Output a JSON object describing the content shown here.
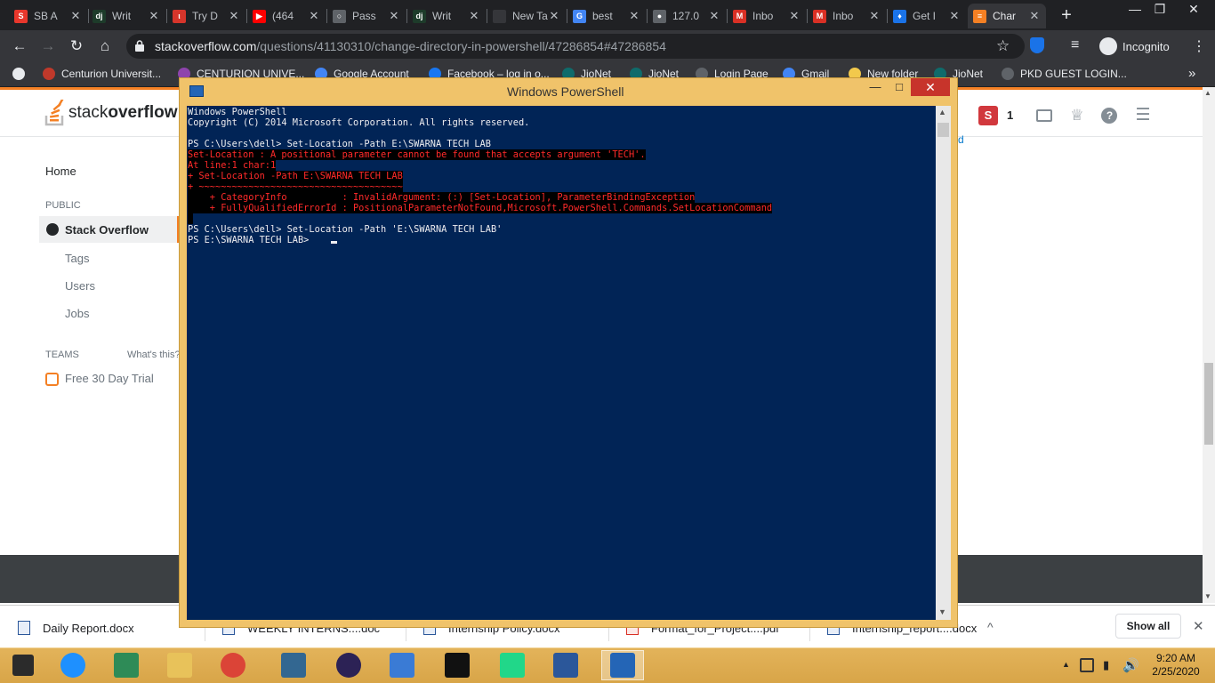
{
  "browser": {
    "tabs": [
      {
        "label": "SB A",
        "favicon": "S",
        "color": "#e8372c"
      },
      {
        "label": "Writ",
        "favicon": "dj",
        "color": "#1d3b2a"
      },
      {
        "label": "Try D",
        "favicon": "ι",
        "color": "#d6352b"
      },
      {
        "label": "(464",
        "favicon": "▶",
        "color": "#ff0000"
      },
      {
        "label": "Pass",
        "favicon": "○",
        "color": "#5f6368"
      },
      {
        "label": "Writ",
        "favicon": "dj",
        "color": "#1d3b2a"
      },
      {
        "label": "New Tab",
        "favicon": "",
        "color": "#35363a"
      },
      {
        "label": "best",
        "favicon": "G",
        "color": "#4285f4"
      },
      {
        "label": "127.0",
        "favicon": "●",
        "color": "#5f6368"
      },
      {
        "label": "Inbo",
        "favicon": "M",
        "color": "#d93025"
      },
      {
        "label": "Inbo",
        "favicon": "M",
        "color": "#d93025"
      },
      {
        "label": "Get I",
        "favicon": "♦",
        "color": "#1a73e8"
      },
      {
        "label": "Char",
        "favicon": "≡",
        "color": "#f48024"
      }
    ],
    "new_tab_label": "+",
    "window_controls": [
      "—",
      "❐",
      "✕"
    ],
    "url_host": "stackoverflow.com",
    "url_path": "/questions/41130310/change-directory-in-powershell/47286854#47286854",
    "incognito_label": "Incognito",
    "bookmarks": [
      {
        "label": "Centurion Universit...",
        "color": "#c0392b"
      },
      {
        "label": "CENTURION UNIVE...",
        "color": "#8e44ad"
      },
      {
        "label": "Google Account",
        "color": "#4285f4"
      },
      {
        "label": "Facebook – log in o...",
        "color": "#1877f2"
      },
      {
        "label": "JioNet",
        "color": "#0f6b6b"
      },
      {
        "label": "JioNet",
        "color": "#0f6b6b"
      },
      {
        "label": "Login Page",
        "color": "#5f6368"
      },
      {
        "label": "Gmail",
        "color": "#4285f4"
      },
      {
        "label": "New folder",
        "color": "#f2c94c"
      },
      {
        "label": "JioNet",
        "color": "#0f6b6b"
      },
      {
        "label": "PKD GUEST LOGIN...",
        "color": "#5f6368"
      }
    ],
    "more_bookmarks": "»"
  },
  "stackoverflow": {
    "logo_light": "stack",
    "logo_bold": "overflow",
    "nav_home": "Home",
    "nav_public": "PUBLIC",
    "nav_stackoverflow": "Stack Overflow",
    "nav_tags": "Tags",
    "nav_users": "Users",
    "nav_jobs": "Jobs",
    "nav_teams": "TEAMS",
    "nav_whats_this": "What's this?",
    "nav_trial": "Free 30 Day Trial",
    "avatar_letter": "S",
    "reputation": "1",
    "partial_link": "d"
  },
  "powershell": {
    "title": "Windows PowerShell",
    "lines": [
      {
        "text": "Windows PowerShell",
        "error": false
      },
      {
        "text": "Copyright (C) 2014 Microsoft Corporation. All rights reserved.",
        "error": false
      },
      {
        "text": "",
        "error": false
      },
      {
        "text": "PS C:\\Users\\dell> Set-Location -Path E:\\SWARNA TECH LAB",
        "error": false
      },
      {
        "text": "Set-Location : A positional parameter cannot be found that accepts argument 'TECH'.",
        "error": true
      },
      {
        "text": "At line:1 char:1",
        "error": true
      },
      {
        "text": "+ Set-Location -Path E:\\SWARNA TECH LAB",
        "error": true
      },
      {
        "text": "+ ~~~~~~~~~~~~~~~~~~~~~~~~~~~~~~~~~~~~~",
        "error": true
      },
      {
        "text": "    + CategoryInfo          : InvalidArgument: (:) [Set-Location], ParameterBindingException",
        "error": true
      },
      {
        "text": "    + FullyQualifiedErrorId : PositionalParameterNotFound,Microsoft.PowerShell.Commands.SetLocationCommand",
        "error": true
      },
      {
        "text": " ",
        "error": true
      },
      {
        "text": "PS C:\\Users\\dell> Set-Location -Path 'E:\\SWARNA TECH LAB'",
        "error": false
      },
      {
        "text": "PS E:\\SWARNA TECH LAB> ",
        "error": false
      }
    ],
    "controls": [
      "—",
      "□",
      "✕"
    ]
  },
  "downloads": {
    "items": [
      "Daily Report.docx",
      "WEEKLY INTERNS....doc",
      "Internship Policy.docx",
      "Format_for_Project....pdf",
      "Internship_report....docx"
    ],
    "show_all": "Show all",
    "close": "✕",
    "expand": "^"
  },
  "taskbar": {
    "time": "9:20 AM",
    "date": "2/25/2020",
    "apps": [
      "start",
      "internet-explorer",
      "store",
      "file-explorer",
      "chrome",
      "postgresql",
      "eclipse",
      "control-panel",
      "cmd",
      "pycharm",
      "word",
      "powershell"
    ]
  }
}
